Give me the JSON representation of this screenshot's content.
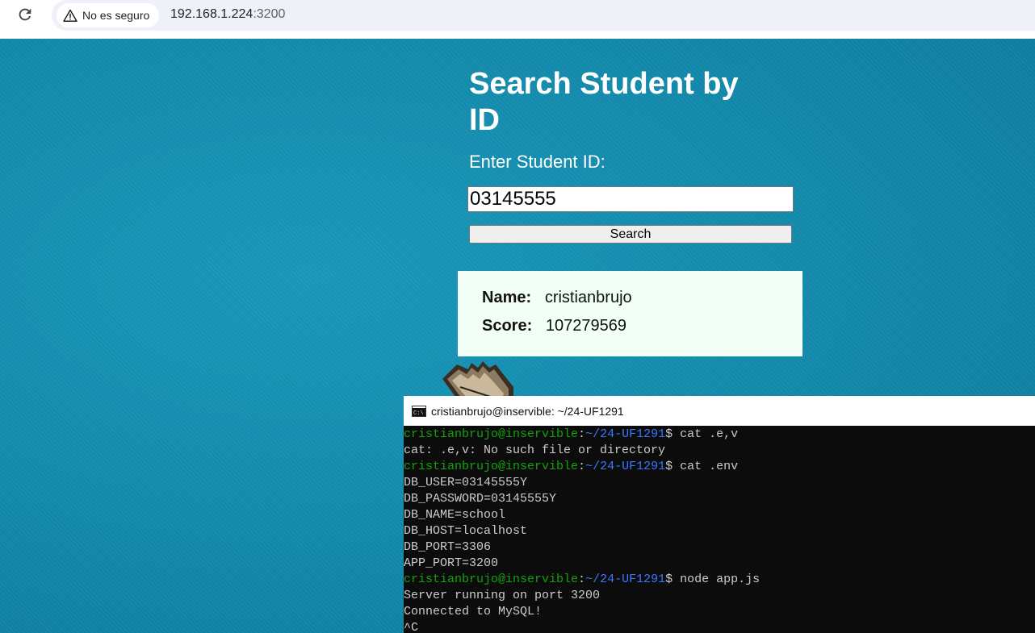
{
  "browser": {
    "security_label": "No es seguro",
    "url_host": "192.168.1.224",
    "url_port": ":3200"
  },
  "page": {
    "title": "Search Student by ID",
    "prompt": "Enter Student ID:",
    "input_value": "03145555",
    "search_label": "Search",
    "result": {
      "name_label": "Name:",
      "name_value": "cristianbrujo",
      "score_label": "Score:",
      "score_value": "107279569"
    }
  },
  "terminal": {
    "title": "cristianbrujo@inservible: ~/24-UF1291",
    "lines": [
      {
        "user": "cristianbrujo@inservible",
        "sep": ":",
        "path": "~/24-UF1291",
        "cmd": "$ cat .e,v"
      },
      {
        "text": "cat: .e,v: No such file or directory"
      },
      {
        "user": "cristianbrujo@inservible",
        "sep": ":",
        "path": "~/24-UF1291",
        "cmd": "$ cat .env"
      },
      {
        "text": "DB_USER=03145555Y"
      },
      {
        "text": "DB_PASSWORD=03145555Y"
      },
      {
        "text": "DB_NAME=school"
      },
      {
        "text": "DB_HOST=localhost"
      },
      {
        "text": "DB_PORT=3306"
      },
      {
        "text": "APP_PORT=3200"
      },
      {
        "user": "cristianbrujo@inservible",
        "sep": ":",
        "path": "~/24-UF1291",
        "cmd": "$ node app.js"
      },
      {
        "text": "Server running on port 3200"
      },
      {
        "text": "Connected to MySQL!"
      },
      {
        "text": "^C"
      }
    ]
  },
  "colors": {
    "page_bg": "#1289ab",
    "prompt_user": "#13a10e",
    "prompt_path": "#3b78ff",
    "result_bg": "#f2fff6"
  }
}
